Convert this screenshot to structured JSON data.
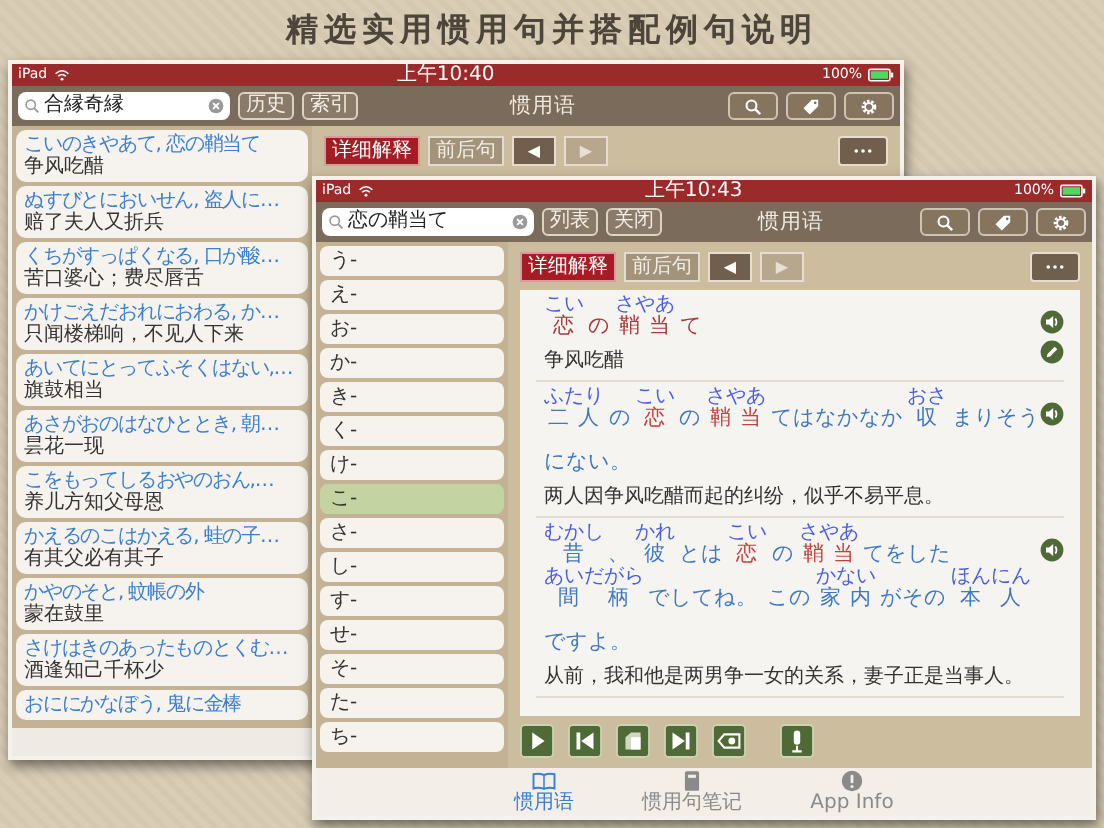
{
  "headline": "精选实用惯用句并搭配例句说明",
  "back_window": {
    "status_bar": {
      "device": "iPad",
      "time": "上午10:40",
      "battery": "100%"
    },
    "search": {
      "value": "合縁奇縁"
    },
    "header_buttons": [
      "历史",
      "索引"
    ],
    "title": "惯用语",
    "phrases": [
      {
        "reading": "こいのきやあて, 恋の鞘当て",
        "meaning": "争风吃醋"
      },
      {
        "reading": "ぬすびとにおいせん, 盗人に…",
        "meaning": "赔了夫人又折兵"
      },
      {
        "reading": "くちがすっぱくなる, 口が酸…",
        "meaning": "苦口婆心；费尽唇舌"
      },
      {
        "reading": "かけごえだおれにおわる, か…",
        "meaning": "只闻楼梯响，不见人下来"
      },
      {
        "reading": "あいてにとってふそくはない,…",
        "meaning": "旗鼓相当"
      },
      {
        "reading": "あさがおのはなひととき, 朝…",
        "meaning": "昙花一现"
      },
      {
        "reading": "こをもってしるおやのおん,…",
        "meaning": "养儿方知父母恩"
      },
      {
        "reading": "かえるのこはかえる, 蛙の子…",
        "meaning": "有其父必有其子"
      },
      {
        "reading": "かやのそと, 蚊帳の外",
        "meaning": "蒙在鼓里"
      },
      {
        "reading": "さけはきのあったものとくむ…",
        "meaning": "酒逢知己千杯少"
      },
      {
        "reading": "おににかなぼう, 鬼に金棒"
      }
    ],
    "mode_tabs": [
      {
        "label": "详细解释",
        "selected": true
      },
      {
        "label": "前后句",
        "selected": false
      }
    ],
    "nav_buttons": [
      {
        "label": "◀",
        "disabled": false
      },
      {
        "label": "▶",
        "disabled": true
      }
    ]
  },
  "front_window": {
    "status_bar": {
      "device": "iPad",
      "time": "上午10:43",
      "battery": "100%"
    },
    "search": {
      "value": "恋の鞘当て"
    },
    "header_buttons": [
      "列表",
      "关闭"
    ],
    "title": "惯用语",
    "index": [
      {
        "label": "う-",
        "selected": false
      },
      {
        "label": "え-",
        "selected": false
      },
      {
        "label": "お-",
        "selected": false
      },
      {
        "label": "か-",
        "selected": false
      },
      {
        "label": "き-",
        "selected": false
      },
      {
        "label": "く-",
        "selected": false
      },
      {
        "label": "け-",
        "selected": false
      },
      {
        "label": "こ-",
        "selected": true
      },
      {
        "label": "さ-",
        "selected": false
      },
      {
        "label": "し-",
        "selected": false
      },
      {
        "label": "す-",
        "selected": false
      },
      {
        "label": "せ-",
        "selected": false
      },
      {
        "label": "そ-",
        "selected": false
      },
      {
        "label": "た-",
        "selected": false
      },
      {
        "label": "ち-",
        "selected": false
      }
    ],
    "mode_tabs": [
      {
        "label": "详细解释",
        "selected": true
      },
      {
        "label": "前后句",
        "selected": false
      }
    ],
    "nav_buttons": [
      {
        "label": "◀",
        "disabled": false
      },
      {
        "label": "▶",
        "disabled": true
      }
    ],
    "entries": [
      {
        "kind": "headword",
        "segments": [
          {
            "text": "恋",
            "ruby": "こい",
            "highlight": true
          },
          {
            "text": "の",
            "highlight": true
          },
          {
            "text": "鞘当",
            "ruby": "さやあ",
            "highlight": true
          },
          {
            "text": "て",
            "highlight": true
          }
        ],
        "translation": "争风吃醋"
      },
      {
        "kind": "example",
        "segments": [
          {
            "text": "二人",
            "ruby": "ふたり",
            "highlight": false
          },
          {
            "text": "の",
            "highlight": false
          },
          {
            "text": "恋",
            "ruby": "こい",
            "highlight": true
          },
          {
            "text": "の",
            "highlight": false
          },
          {
            "text": "鞘当",
            "ruby": "さやあ",
            "highlight": true
          },
          {
            "text": "てはなかなか",
            "highlight": false
          },
          {
            "text": "収",
            "ruby": "おさ",
            "highlight": false
          },
          {
            "text": "まりそう",
            "highlight": false
          },
          {
            "text": "にない。",
            "highlight": false
          }
        ],
        "translation": "两人因争风吃醋而起的纠纷，似乎不易平息。"
      },
      {
        "kind": "example",
        "segments": [
          {
            "text": "昔",
            "ruby": "むかし",
            "highlight": false
          },
          {
            "text": "、",
            "highlight": false
          },
          {
            "text": "彼",
            "ruby": "かれ",
            "highlight": false
          },
          {
            "text": "とは",
            "highlight": false
          },
          {
            "text": "恋",
            "ruby": "こい",
            "highlight": true
          },
          {
            "text": "の",
            "highlight": false
          },
          {
            "text": "鞘当",
            "ruby": "さやあ",
            "highlight": true
          },
          {
            "text": "てをした",
            "highlight": false
          },
          {
            "text": "間柄",
            "ruby": "あいだがら",
            "highlight": false
          },
          {
            "text": "でしてね。",
            "highlight": false
          },
          {
            "text": "この",
            "highlight": false
          },
          {
            "text": "家内",
            "ruby": "かない",
            "highlight": false
          },
          {
            "text": "がその",
            "highlight": false
          },
          {
            "text": "本人",
            "ruby": "ほんにん",
            "highlight": false
          },
          {
            "text": "ですよ。",
            "highlight": false
          }
        ],
        "translation": "从前，我和他是两男争一女的关系，妻子正是当事人。"
      }
    ],
    "tabs": [
      {
        "label": "惯用语",
        "selected": true
      },
      {
        "label": "惯用句笔记",
        "selected": false
      },
      {
        "label": "App Info",
        "selected": false
      }
    ]
  }
}
